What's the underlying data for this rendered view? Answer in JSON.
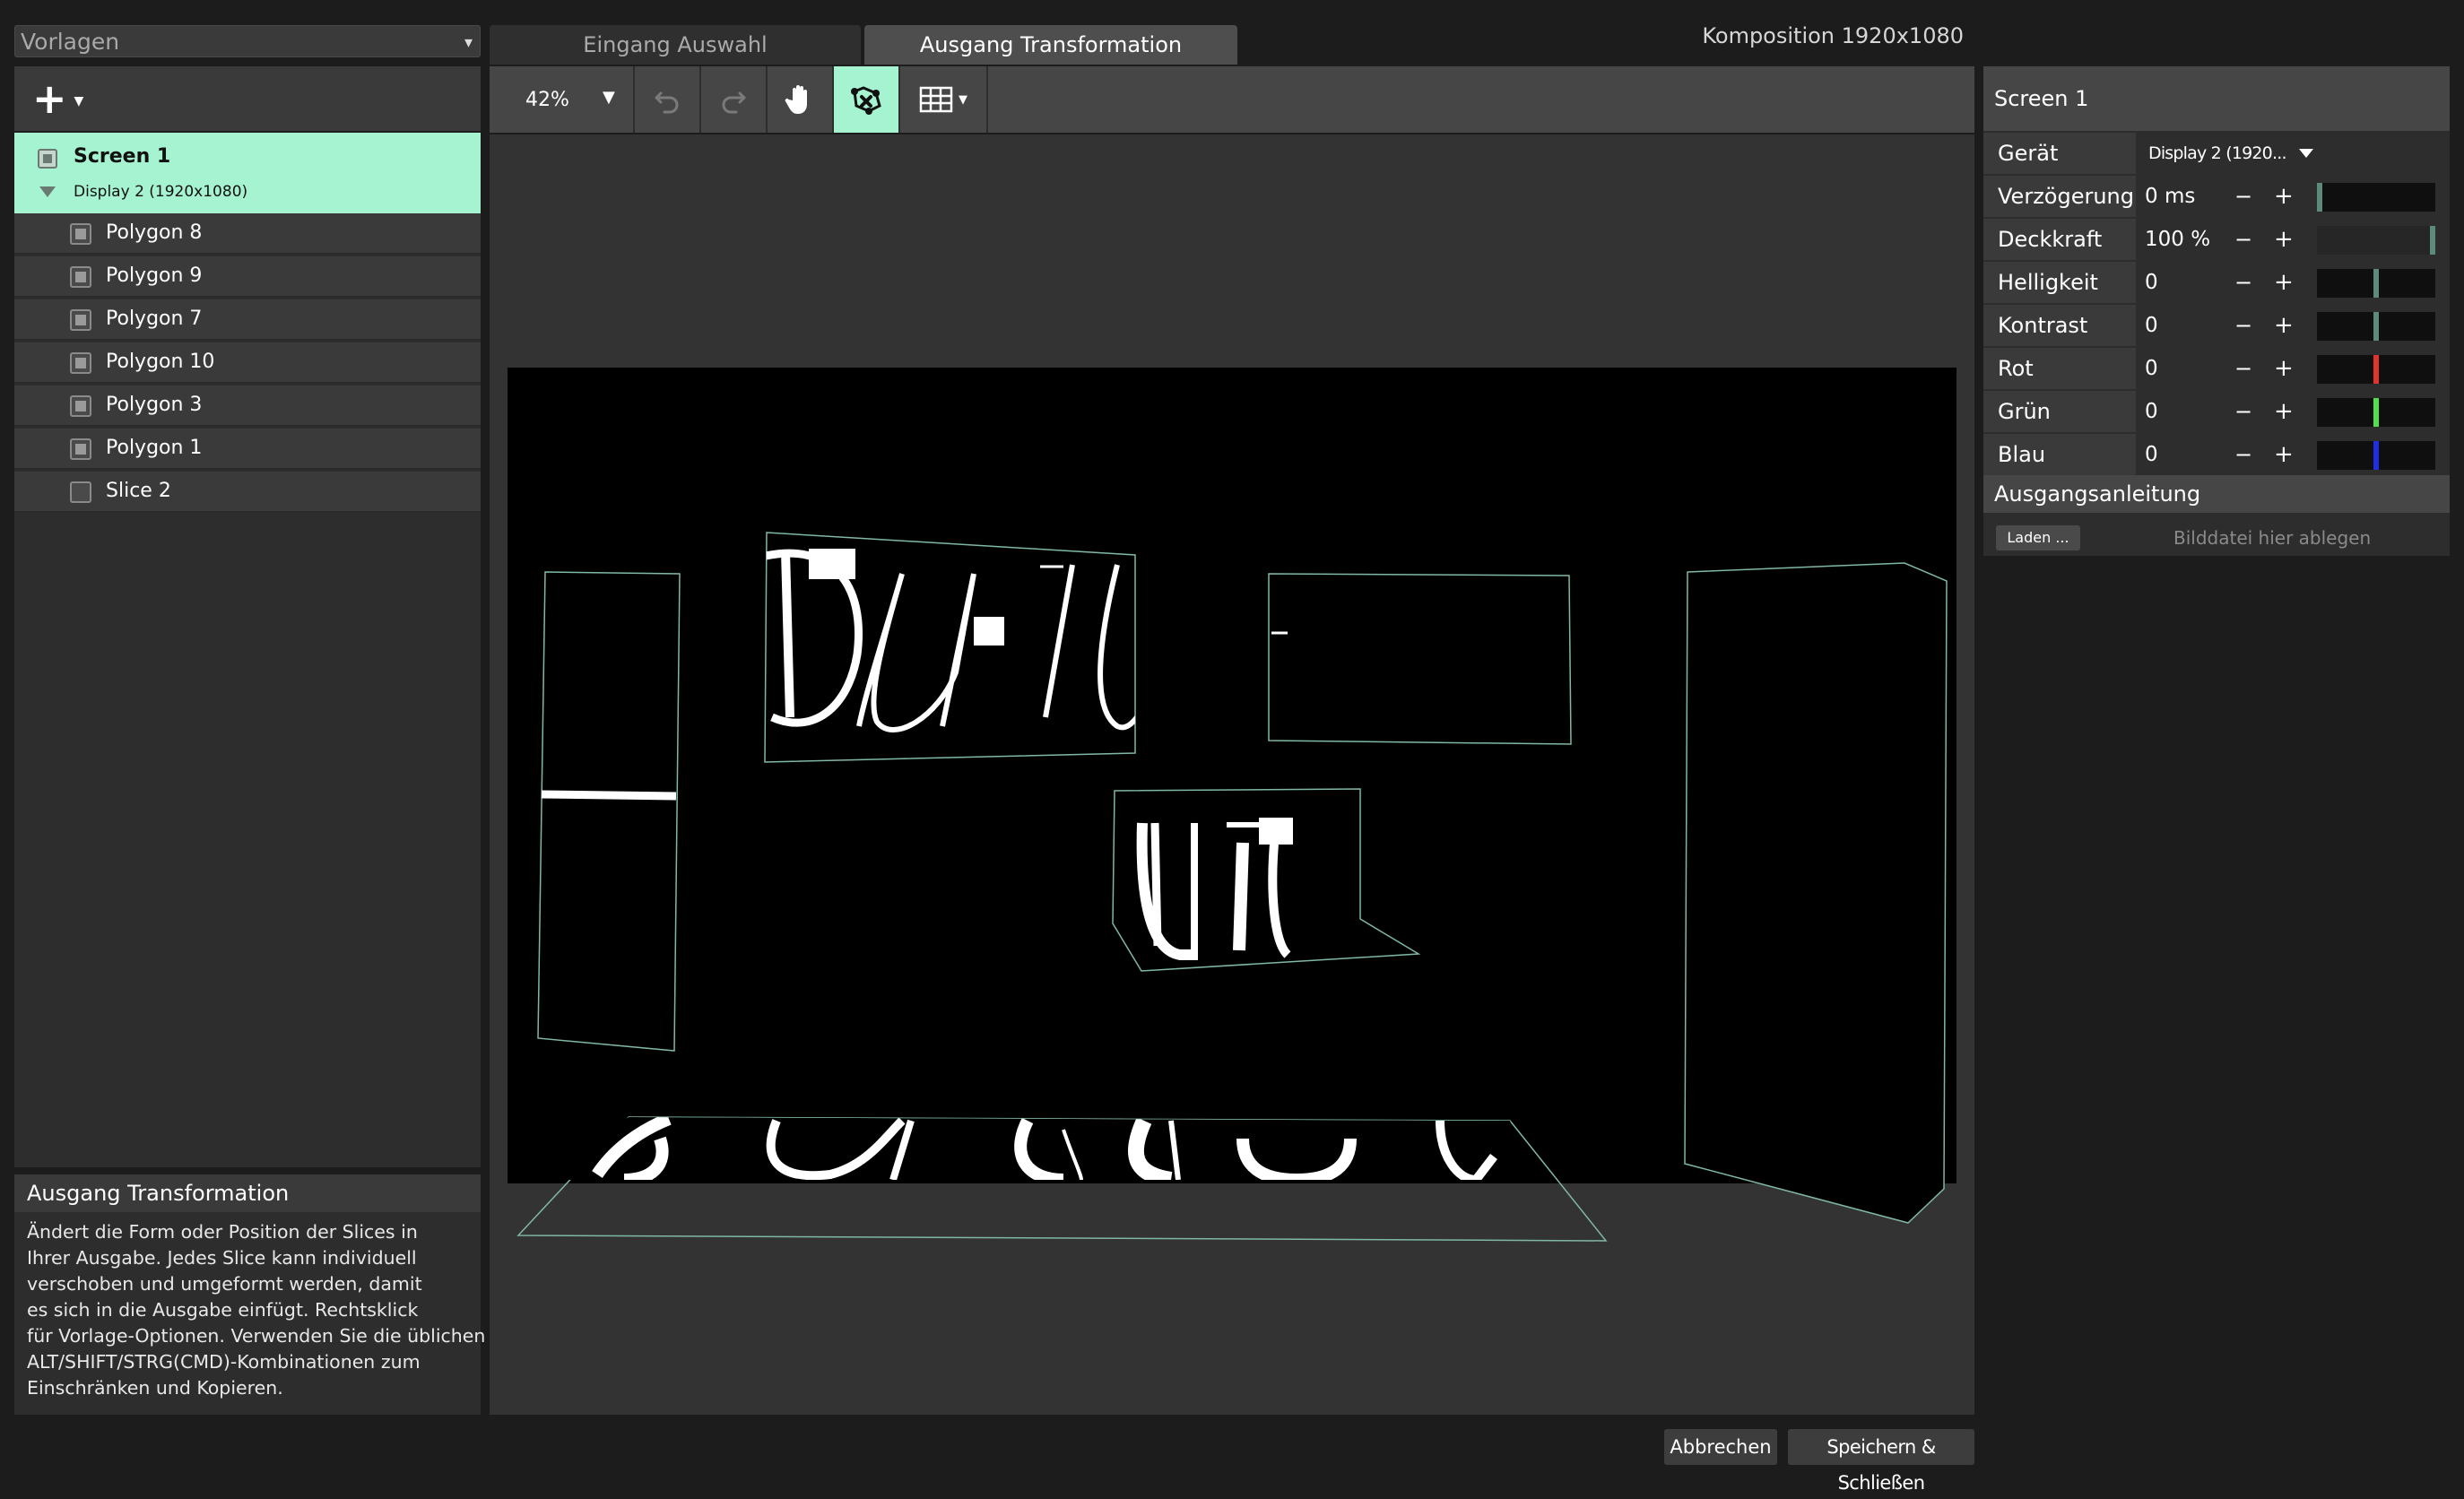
{
  "templates": {
    "label": "Vorlagen"
  },
  "slices": {
    "screen": {
      "name": "Screen 1",
      "device": "Display 2 (1920x1080)"
    },
    "items": [
      {
        "label": "Polygon 8",
        "checked": true
      },
      {
        "label": "Polygon 9",
        "checked": true
      },
      {
        "label": "Polygon 7",
        "checked": true
      },
      {
        "label": "Polygon 10",
        "checked": true
      },
      {
        "label": "Polygon 3",
        "checked": true
      },
      {
        "label": "Polygon 1",
        "checked": true
      },
      {
        "label": "Slice 2",
        "checked": false
      }
    ]
  },
  "help": {
    "title": "Ausgang Transformation",
    "lines": [
      "Ändert die Form oder Position der Slices in",
      "Ihrer Ausgabe. Jedes Slice kann individuell",
      "verschoben und umgeformt werden, damit",
      "es sich in die Ausgabe einfügt. Rechtsklick",
      "für Vorlage-Optionen. Verwenden Sie die üblichen",
      "ALT/SHIFT/STRG(CMD)-Kombinationen zum",
      "Einschränken und Kopieren."
    ]
  },
  "tabs": [
    {
      "label": "Eingang Auswahl",
      "active": false
    },
    {
      "label": "Ausgang Transformation",
      "active": true
    }
  ],
  "composition": "Komposition 1920x1080",
  "toolbar": {
    "zoom": "42%",
    "icons": [
      "undo-icon",
      "redo-icon",
      "hand-icon",
      "warp-icon",
      "grid-icon"
    ],
    "active_tool": "warp-icon"
  },
  "properties": {
    "title": "Screen 1",
    "device": {
      "label": "Gerät",
      "value": "Display 2 (1920..."
    },
    "rows": [
      {
        "label": "Verzögerung",
        "value": "0 ms",
        "level": 0.0,
        "color": "#5e8a7c"
      },
      {
        "label": "Deckkraft",
        "value": "100 %",
        "level": 1.0,
        "color": "#5e8a7c"
      },
      {
        "label": "Helligkeit",
        "value": "0",
        "level": 0.5,
        "color": "#5e8a7c"
      },
      {
        "label": "Kontrast",
        "value": "0",
        "level": 0.5,
        "color": "#5e8a7c"
      },
      {
        "label": "Rot",
        "value": "0",
        "level": 0.5,
        "color": "#e0352b"
      },
      {
        "label": "Grün",
        "value": "0",
        "level": 0.5,
        "color": "#4fe04a"
      },
      {
        "label": "Blau",
        "value": "0",
        "level": 0.5,
        "color": "#1e2ee0"
      }
    ],
    "minus": "−",
    "plus": "+"
  },
  "output_guide": {
    "title": "Ausgangsanleitung",
    "load_button": "Laden ...",
    "drop_hint": "Bilddatei hier ablegen"
  },
  "footer": {
    "cancel": "Abbrechen",
    "save": "Speichern & Schließen"
  },
  "colors": {
    "accent": "#a6f3d1",
    "outline": "#7fb8a8"
  }
}
